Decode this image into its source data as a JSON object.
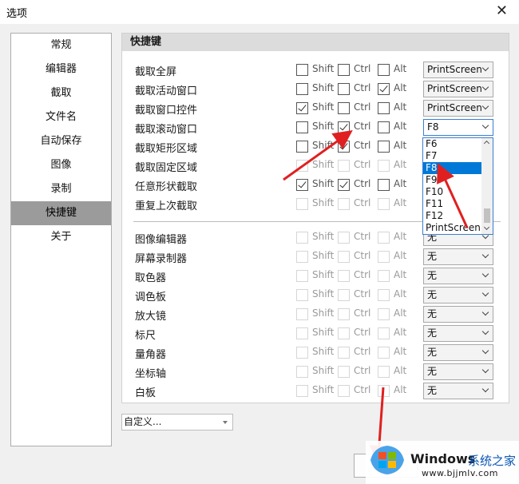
{
  "window": {
    "title": "选项",
    "close_icon": "close-icon"
  },
  "nav": {
    "items": [
      "常规",
      "编辑器",
      "截取",
      "文件名",
      "自动保存",
      "图像",
      "录制",
      "快捷键",
      "关于"
    ],
    "active_index": 7
  },
  "panel": {
    "title": "快捷键",
    "checkbox_labels": {
      "shift": "Shift",
      "ctrl": "Ctrl",
      "alt": "Alt"
    },
    "rows_top": [
      {
        "label": "截取全屏",
        "shift": false,
        "ctrl": false,
        "alt": false,
        "key": "PrintScreen",
        "enabled": true
      },
      {
        "label": "截取活动窗口",
        "shift": false,
        "ctrl": false,
        "alt": true,
        "key": "PrintScreen",
        "enabled": true
      },
      {
        "label": "截取窗口控件",
        "shift": true,
        "ctrl": false,
        "alt": false,
        "key": "PrintScreen",
        "enabled": true
      },
      {
        "label": "截取滚动窗口",
        "shift": false,
        "ctrl": true,
        "alt": false,
        "key": "F8",
        "enabled": true
      },
      {
        "label": "截取矩形区域",
        "shift": false,
        "ctrl": true,
        "alt": false,
        "key": "",
        "enabled": true
      },
      {
        "label": "截取固定区域",
        "shift": false,
        "ctrl": false,
        "alt": false,
        "key": "",
        "enabled": false
      },
      {
        "label": "任意形状截取",
        "shift": true,
        "ctrl": true,
        "alt": false,
        "key": "",
        "enabled": true
      },
      {
        "label": "重复上次截取",
        "shift": false,
        "ctrl": false,
        "alt": false,
        "key": "",
        "enabled": false
      }
    ],
    "rows_bottom": [
      {
        "label": "图像编辑器",
        "key": "无"
      },
      {
        "label": "屏幕录制器",
        "key": "无"
      },
      {
        "label": "取色器",
        "key": "无"
      },
      {
        "label": "调色板",
        "key": "无"
      },
      {
        "label": "放大镜",
        "key": "无"
      },
      {
        "label": "标尺",
        "key": "无"
      },
      {
        "label": "量角器",
        "key": "无"
      },
      {
        "label": "坐标轴",
        "key": "无"
      },
      {
        "label": "白板",
        "key": "无"
      }
    ]
  },
  "dropdown": {
    "options": [
      "F6",
      "F7",
      "F8",
      "F9",
      "F10",
      "F11",
      "F12",
      "PrintScreen"
    ],
    "selected": "F8"
  },
  "preset": {
    "value": "自定义..."
  },
  "watermark": {
    "brand": "Windows",
    "site_cn": "系统之家",
    "url": "www.bjjmlv.com"
  },
  "colors": {
    "accent": "#0078d7",
    "nav_active": "#9b9b9b",
    "arrow": "#e02020"
  }
}
